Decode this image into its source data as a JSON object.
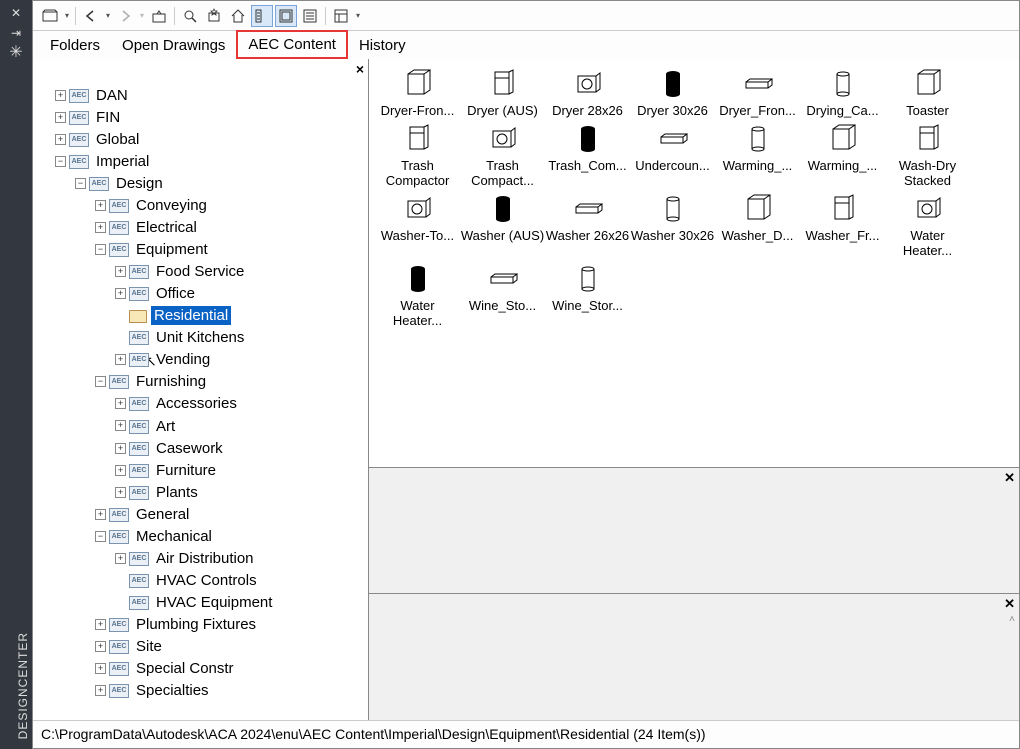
{
  "window": {
    "title": "DESIGNCENTER"
  },
  "tabs": {
    "folders": "Folders",
    "open_drawings": "Open Drawings",
    "aec_content": "AEC Content",
    "history": "History",
    "active": "aec_content"
  },
  "tree": {
    "dan": "DAN",
    "fin": "FIN",
    "global": "Global",
    "imperial": "Imperial",
    "design": "Design",
    "conveying": "Conveying",
    "electrical": "Electrical",
    "equipment": "Equipment",
    "food_service": "Food Service",
    "office": "Office",
    "residential": "Residential",
    "unit_kitchens": "Unit Kitchens",
    "vending": "Vending",
    "furnishing": "Furnishing",
    "accessories": "Accessories",
    "art": "Art",
    "casework": "Casework",
    "furniture": "Furniture",
    "plants": "Plants",
    "general": "General",
    "mechanical": "Mechanical",
    "air_distribution": "Air Distribution",
    "hvac_controls": "HVAC Controls",
    "hvac_equipment": "HVAC Equipment",
    "plumbing_fixtures": "Plumbing Fixtures",
    "site": "Site",
    "special_constr": "Special Constr",
    "specialties": "Specialties"
  },
  "items": [
    "Dryer-Fron...",
    "Dryer (AUS)",
    "Dryer 28x26",
    "Dryer 30x26",
    "Dryer_Fron...",
    "Drying_Ca...",
    "Toaster",
    "Trash Compactor",
    "Trash Compact...",
    "Trash_Com...",
    "Undercoun...",
    "Warming_...",
    "Warming_...",
    "Wash-Dry Stacked",
    "Washer-To...",
    "Washer (AUS)",
    "Washer 26x26",
    "Washer 30x26",
    "Washer_D...",
    "Washer_Fr...",
    "Water Heater...",
    "Water Heater...",
    "Wine_Sto...",
    "Wine_Stor..."
  ],
  "status": "C:\\ProgramData\\Autodesk\\ACA 2024\\enu\\AEC Content\\Imperial\\Design\\Equipment\\Residential (24 Item(s))"
}
